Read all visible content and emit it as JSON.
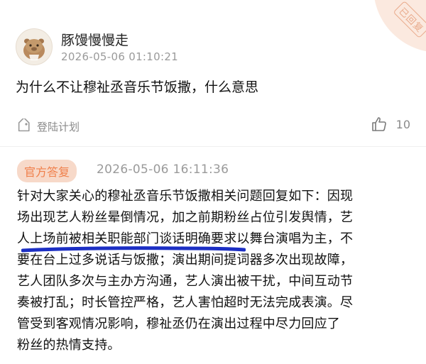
{
  "post": {
    "username": "豚馒慢慢走",
    "timestamp": "2026-05-06 01:10:21",
    "question": "为什么不让穆祉丞音乐节饭撒，什么意思",
    "tag_label": "登陆计划",
    "like_count": "10",
    "stamp_text": "已回复"
  },
  "reply": {
    "badge": "官方答复",
    "timestamp": "2026-05-06 16:11:36",
    "lines": [
      "针对大家关心的穆祉丞音乐节饭撒相关问题回复如下：因现",
      "场出现艺人粉丝晕倒情况，加之前期粉丝占位引发舆情，艺",
      "人上场前被相关职能部门谈话明确要求以舞台演唱为主，不",
      "要在台上过多说话与饭撒；演出期间提词器多次出现故障，",
      "艺人团队多次与主办方沟通，艺人演出被干扰，中间互动节",
      "奏被打乱；时长管控严格，艺人害怕超时无法完成表演。尽",
      "管受到客观情况影响，穆祉丞仍在演出过程中尽力回应了",
      "粉丝的热情支持。"
    ]
  },
  "colors": {
    "accent": "#f07f4a",
    "badge_bg": "#f7d9c9",
    "underline": "#1c2fc4",
    "meta_gray": "#9a9a9a"
  },
  "icons": {
    "avatar": "capybara-avatar",
    "tag": "tag-icon",
    "like": "thumbs-up-icon"
  }
}
